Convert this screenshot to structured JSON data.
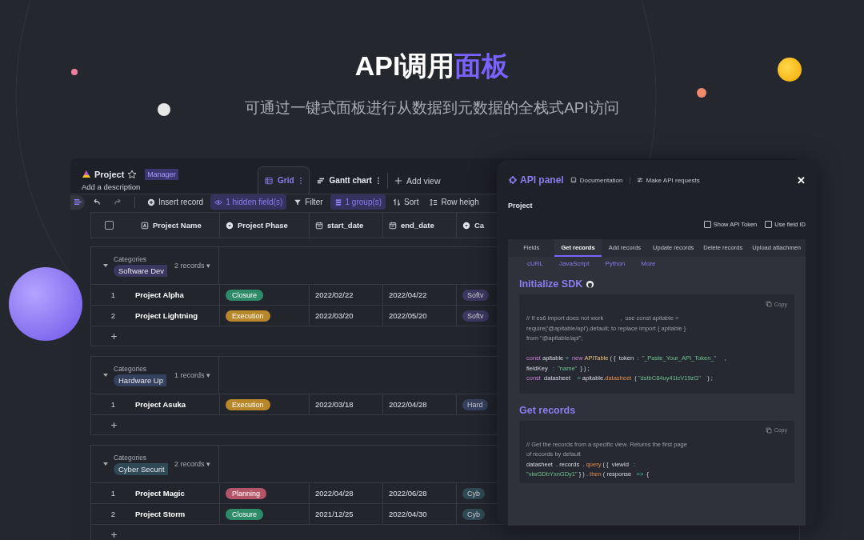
{
  "headline": {
    "lead": "API调用",
    "highlight": "面板"
  },
  "subtitle": "可通过一键式面板进行从数据到元数据的全栈式API访问",
  "grid_window": {
    "project": {
      "title": "Project",
      "role": "Manager",
      "description": "Add a description"
    },
    "views": [
      {
        "label": "Grid",
        "kind": "grid",
        "selected": true
      },
      {
        "label": "Gantt chart",
        "kind": "gantt",
        "selected": false
      }
    ],
    "add_view": "Add view",
    "toolbar": [
      {
        "label": "Insert record",
        "kind": "insert",
        "active": false
      },
      {
        "label": "1 hidden field(s)",
        "kind": "eye",
        "active": true
      },
      {
        "label": "Filter",
        "kind": "filter",
        "active": false
      },
      {
        "label": "1 group(s)",
        "kind": "group",
        "active": true
      },
      {
        "label": "Sort",
        "kind": "sort",
        "active": false
      },
      {
        "label": "Row heigh",
        "kind": "height",
        "active": false
      }
    ],
    "select_all": {
      "checked": false
    },
    "columns": [
      {
        "label": "Project Name",
        "kind": "text"
      },
      {
        "label": "Project Phase",
        "kind": "select"
      },
      {
        "label": "start_date",
        "kind": "date"
      },
      {
        "label": "end_date",
        "kind": "date"
      },
      {
        "label": "Ca",
        "kind": "select"
      }
    ],
    "groups": [
      {
        "field": "Categories",
        "value": "Software Dev",
        "color": "#3b3760",
        "count": "2 records ▾",
        "rows": [
          {
            "num": "1",
            "name": "Project Alpha",
            "phase": {
              "label": "Closure",
              "color": "#2e8b6a"
            },
            "start": "2022/02/22",
            "end": "2022/04/22",
            "category": "Softv"
          },
          {
            "num": "2",
            "name": "Project Lightning",
            "phase": {
              "label": "Execution",
              "color": "#b8872a"
            },
            "start": "2022/03/20",
            "end": "2022/05/20",
            "category": "Softv"
          }
        ]
      },
      {
        "field": "Categories",
        "value": "Hardware Up",
        "color": "#34405e",
        "count": "1 records ▾",
        "rows": [
          {
            "num": "1",
            "name": "Project Asuka",
            "phase": {
              "label": "Execution",
              "color": "#b8872a"
            },
            "start": "2022/03/18",
            "end": "2022/04/28",
            "category": "Hard"
          }
        ]
      },
      {
        "field": "Categories",
        "value": "Cyber Securit",
        "color": "#2f4a55",
        "count": "2 records ▾",
        "rows": [
          {
            "num": "1",
            "name": "Project Magic",
            "phase": {
              "label": "Planning",
              "color": "#b45468"
            },
            "start": "2022/04/28",
            "end": "2022/06/28",
            "category": "Cyb"
          },
          {
            "num": "2",
            "name": "Project Storm",
            "phase": {
              "label": "Closure",
              "color": "#2e8b6a"
            },
            "start": "2021/12/25",
            "end": "2022/04/30",
            "category": "Cyb"
          }
        ]
      }
    ]
  },
  "api_panel": {
    "title": "API panel",
    "links": [
      "Documentation",
      "Make API requests"
    ],
    "close": "✕",
    "datasheet": "Project",
    "options": [
      {
        "label": "Show API Token",
        "checked": false
      },
      {
        "label": "Use field ID",
        "checked": false
      }
    ],
    "tabs": [
      {
        "label": "Fields",
        "selected": false
      },
      {
        "label": "Get records",
        "selected": true
      },
      {
        "label": "Add records",
        "selected": false
      },
      {
        "label": "Update records",
        "selected": false
      },
      {
        "label": "Delete records",
        "selected": false
      },
      {
        "label": "Upload attachmen",
        "selected": false
      }
    ],
    "languages": [
      "cURL",
      "JavaScript",
      "Python",
      "More"
    ],
    "sections": [
      {
        "heading": "Initialize SDK",
        "github_icon": true,
        "copy": "Copy",
        "paragraphs": [
          [
            [
              {
                "kind": "comment",
                "text": "// If es6 import does not work          ,  use const apitable ="
              }
            ],
            [
              {
                "kind": "comment",
                "text": "require('@apitable/api').default; to replace import { apitable }"
              }
            ],
            [
              {
                "kind": "comment",
                "text": "from \"@apitable/api\";"
              }
            ]
          ],
          [
            [
              {
                "kind": "keyword",
                "text": "const"
              },
              {
                "kind": "plain",
                "text": " apitable "
              },
              {
                "kind": "op",
                "text": "= "
              },
              {
                "kind": "keyword",
                "text": " new "
              },
              {
                "kind": "class",
                "text": "APITable"
              },
              {
                "kind": "plain",
                "text": " ( {  token  "
              },
              {
                "kind": "op",
                "text": ": "
              },
              {
                "kind": "string",
                "text": " \"_Paste_Your_API_Token_\""
              },
              {
                "kind": "plain",
                "text": "     ,"
              }
            ],
            [
              {
                "kind": "plain",
                "text": "fieldKey   "
              },
              {
                "kind": "op",
                "text": ": "
              },
              {
                "kind": "string",
                "text": " \"name\""
              },
              {
                "kind": "plain",
                "text": "  } ) ;"
              }
            ],
            [
              {
                "kind": "keyword",
                "text": "const"
              },
              {
                "kind": "plain",
                "text": "  datasheet    "
              },
              {
                "kind": "op",
                "text": "="
              },
              {
                "kind": "plain",
                "text": " apitable."
              },
              {
                "kind": "function",
                "text": "datasheet"
              },
              {
                "kind": "plain",
                "text": "  ( "
              },
              {
                "kind": "string",
                "text": "\"dstbC84uy41icV19zG\""
              },
              {
                "kind": "plain",
                "text": "    ) ;"
              }
            ]
          ]
        ]
      },
      {
        "heading": "Get records",
        "github_icon": false,
        "copy": "Copy",
        "paragraphs": [
          [
            [
              {
                "kind": "comment",
                "text": "// Get the records from a specific view. Returns the first page"
              }
            ],
            [
              {
                "kind": "comment",
                "text": "of records by default"
              }
            ],
            [
              {
                "kind": "plain",
                "text": "datasheet  . records  . "
              },
              {
                "kind": "function",
                "text": "query"
              },
              {
                "kind": "plain",
                "text": " ( {  viewId   "
              },
              {
                "kind": "op",
                "text": ":"
              }
            ],
            [
              {
                "kind": "string",
                "text": "\"viwGDbYxnGDy1\""
              },
              {
                "kind": "plain",
                "text": " } ) . "
              },
              {
                "kind": "function",
                "text": "then"
              },
              {
                "kind": "plain",
                "text": " ( response   "
              },
              {
                "kind": "op",
                "text": "=>"
              },
              {
                "kind": "plain",
                "text": "  {"
              }
            ]
          ]
        ]
      }
    ]
  }
}
